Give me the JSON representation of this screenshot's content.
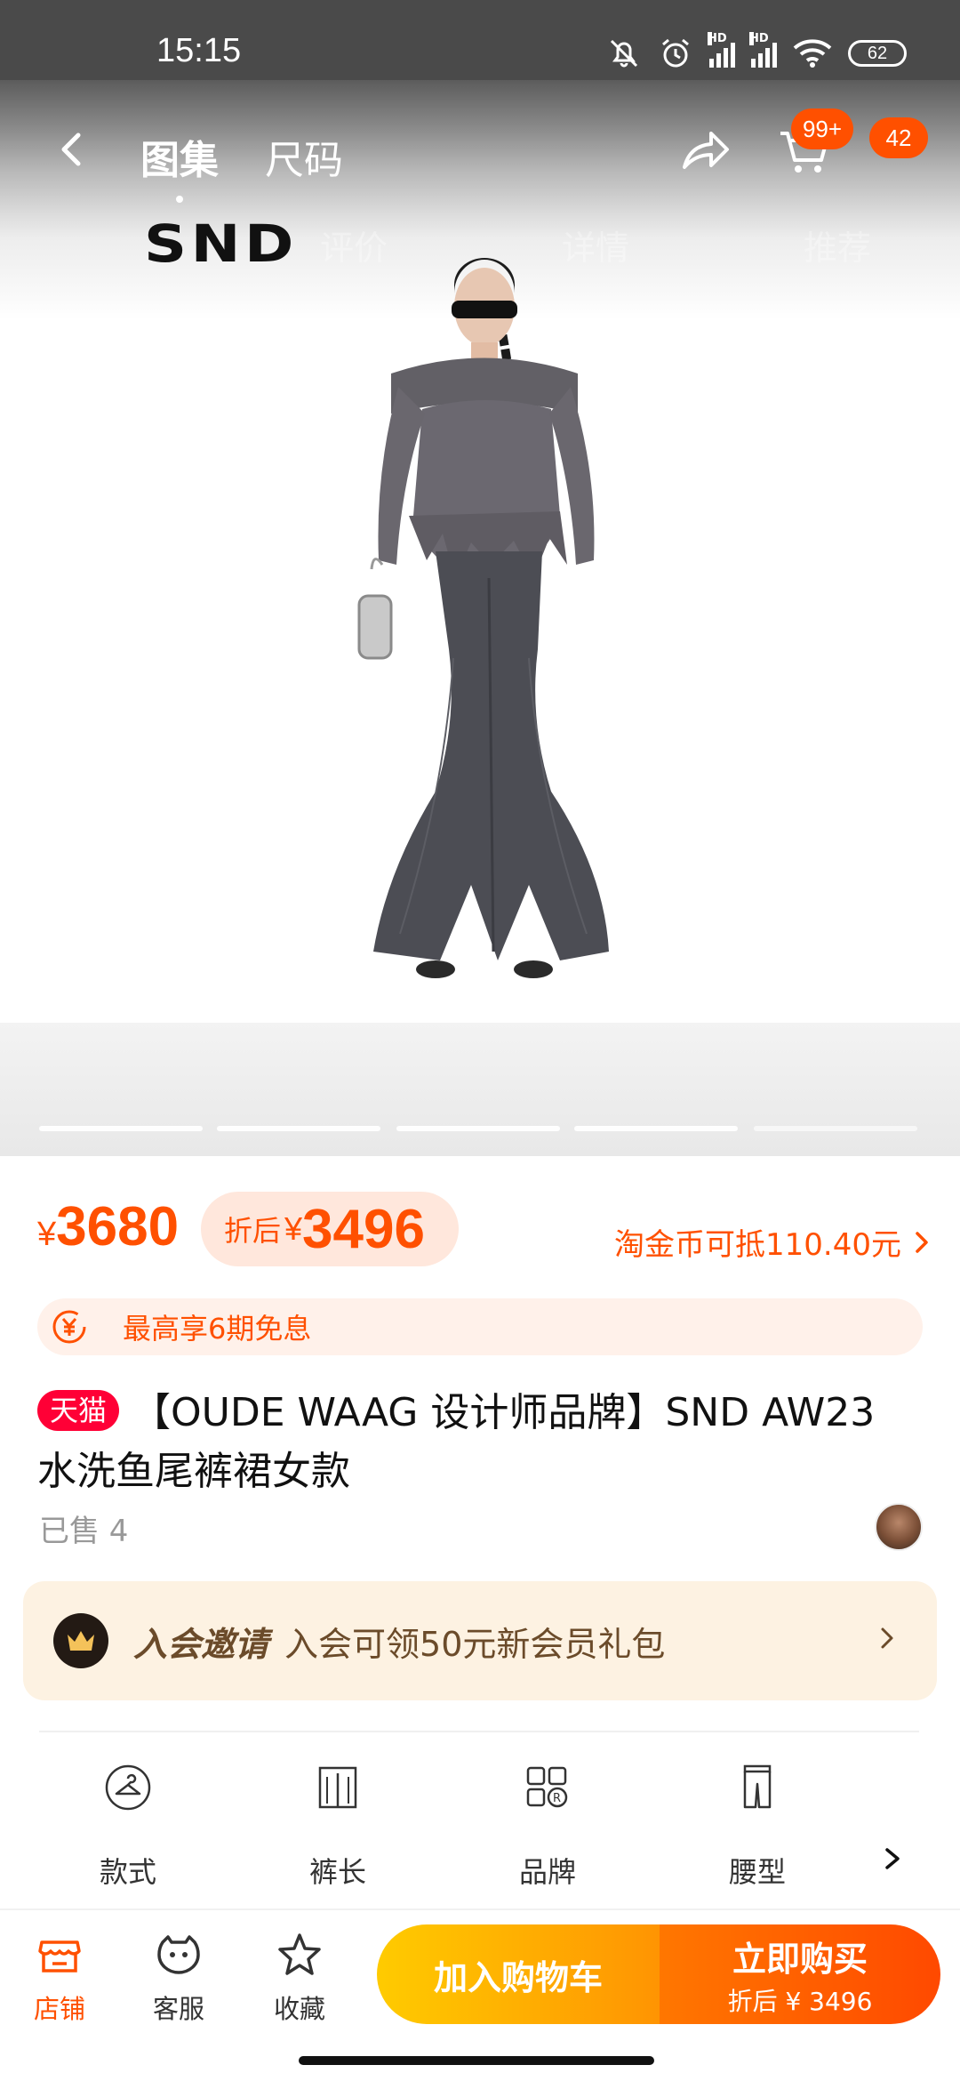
{
  "status_bar": {
    "time": "15:15",
    "battery": "62",
    "signal_labels": [
      "HD",
      "HD"
    ]
  },
  "nav": {
    "tabs": [
      {
        "label": "图集"
      },
      {
        "label": "尺码"
      }
    ],
    "cart_badge": "99+",
    "message_badge": "42",
    "section_tabs": [
      "评价",
      "详情",
      "推荐"
    ]
  },
  "brand": {
    "logo_text": "SND"
  },
  "gallery": {
    "total_images": 5,
    "current_index": 1
  },
  "price": {
    "currency": "¥",
    "original": "3680",
    "discount_label": "折后",
    "discounted": "3496",
    "coin_offset": "淘金币可抵110.40元"
  },
  "installment": {
    "text": "最高享6期免息"
  },
  "product": {
    "badge": "天猫",
    "title": "【OUDE WAAG 设计师品牌】SND AW23 水洗鱼尾裤裙女款",
    "sold": "已售 4"
  },
  "member": {
    "strong": "入会邀请",
    "text": "入会可领50元新会员礼包"
  },
  "attributes": [
    {
      "label": "款式",
      "icon": "hanger-icon"
    },
    {
      "label": "裤长",
      "icon": "trouser-length-icon"
    },
    {
      "label": "品牌",
      "icon": "brand-icon"
    },
    {
      "label": "腰型",
      "icon": "waist-icon"
    }
  ],
  "bottom_bar": {
    "store": "店铺",
    "service": "客服",
    "favorite": "收藏",
    "add_to_cart": "加入购物车",
    "buy_now": "立即购买",
    "buy_now_sub": "折后 ¥ 3496"
  },
  "colors": {
    "accent": "#ff5000",
    "tmall": "#ff0036",
    "member_bg": "#fdf2e2"
  }
}
